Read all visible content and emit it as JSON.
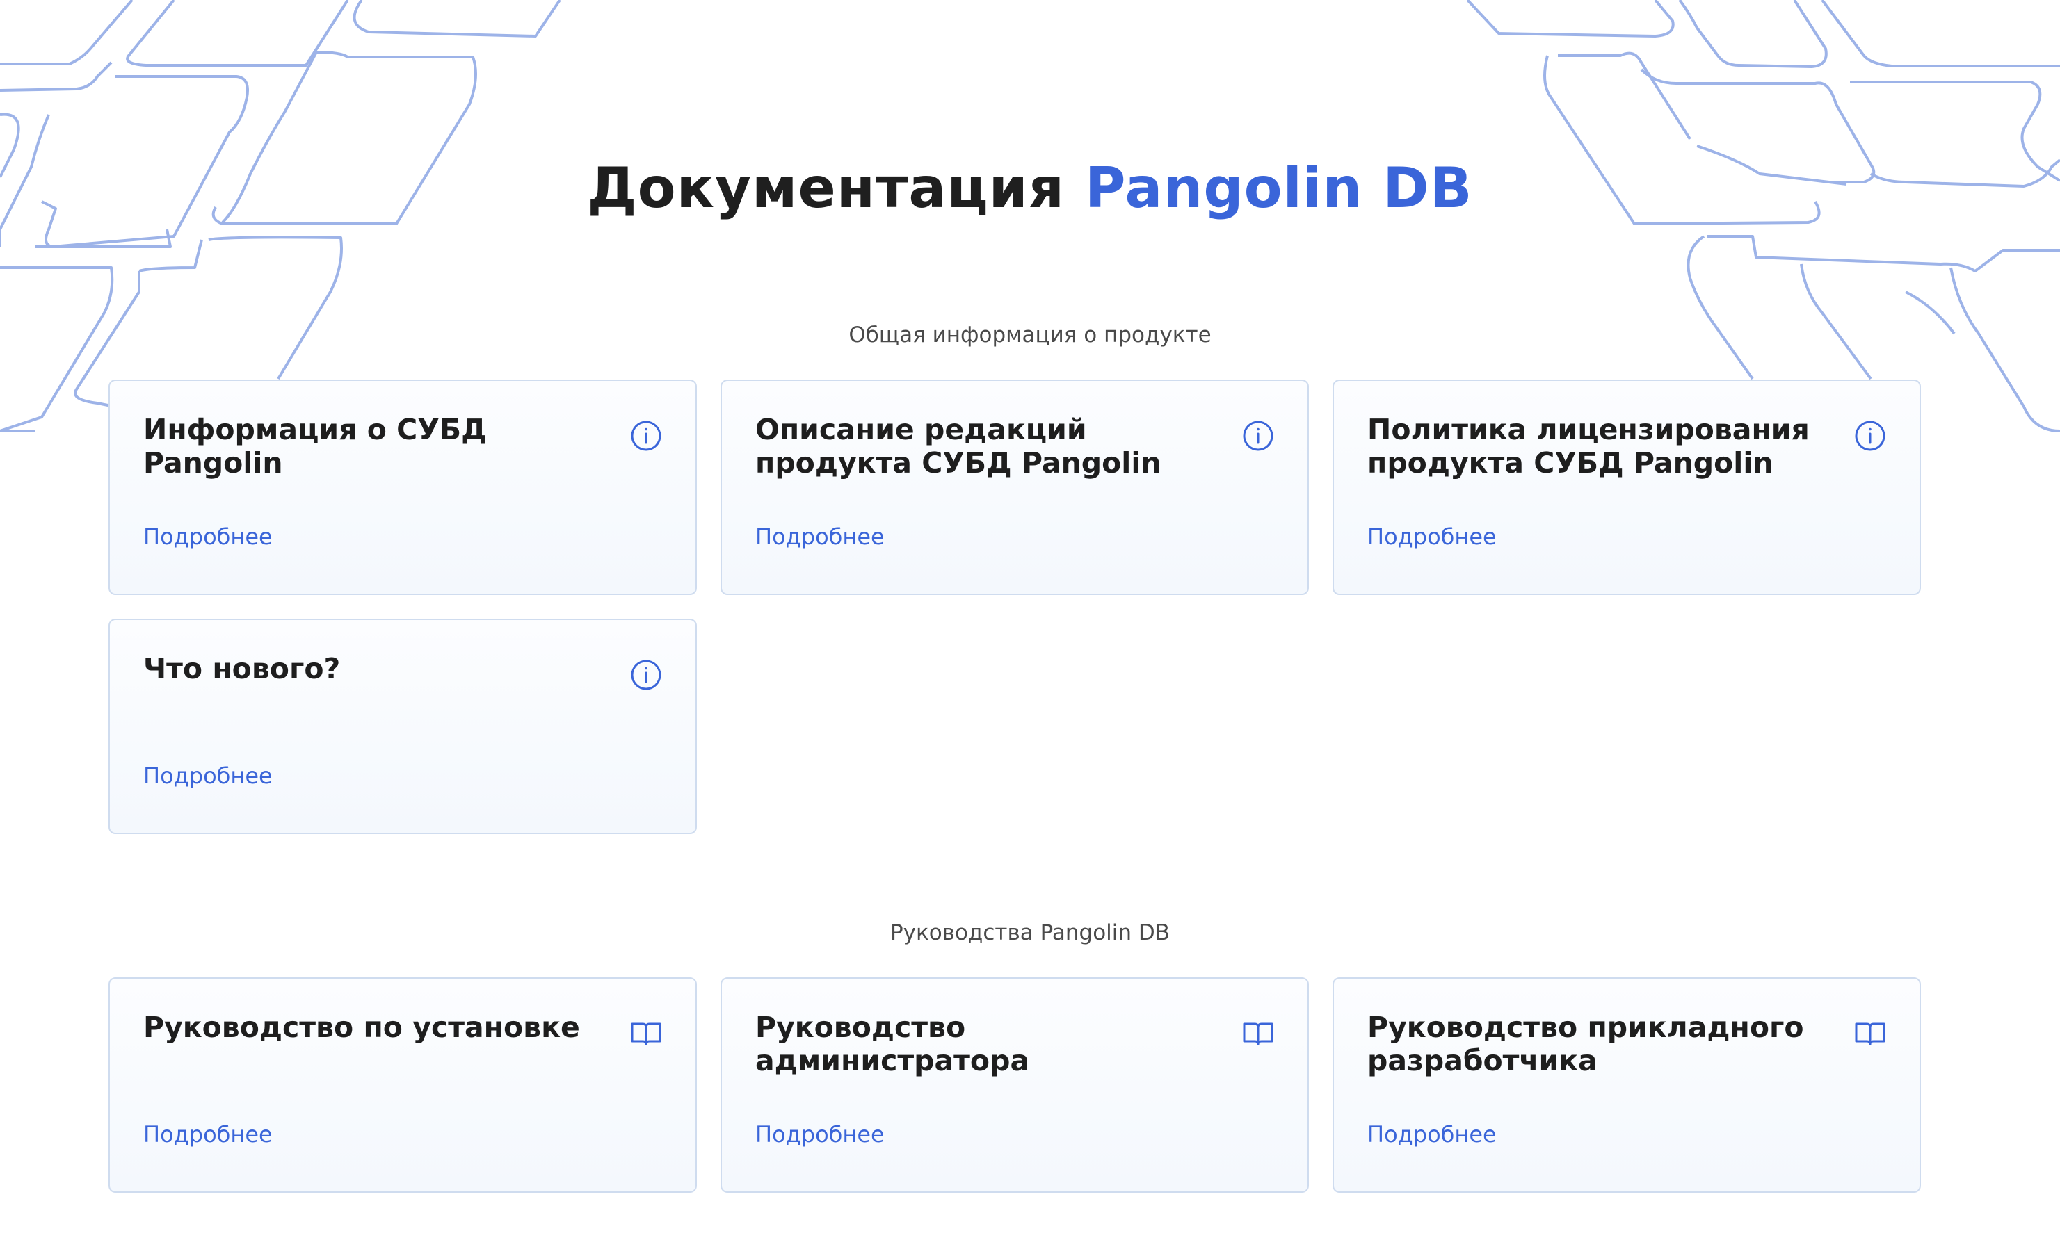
{
  "header": {
    "title_main": "Документация",
    "title_accent": "Pangolin DB"
  },
  "colors": {
    "accent": "#3a65d9",
    "text": "#1e1e1e",
    "card_border": "#cfdcef",
    "decoration_stroke": "#9db3e8"
  },
  "sections": [
    {
      "label": "Общая информация о продукте",
      "icon": "info-icon",
      "cards": [
        {
          "title": "Информация о СУБД Pangolin",
          "link": "Подробнее"
        },
        {
          "title": "Описание редакций продукта СУБД Pangolin",
          "link": "Подробнее"
        },
        {
          "title": "Политика лицензирования продукта СУБД Pangolin",
          "link": "Подробнее"
        },
        {
          "title": "Что нового?",
          "link": "Подробнее"
        }
      ]
    },
    {
      "label": "Руководства Pangolin DB",
      "icon": "book-icon",
      "cards": [
        {
          "title": "Руководство по установке",
          "link": "Подробнее"
        },
        {
          "title": "Руководство администратора",
          "link": "Подробнее"
        },
        {
          "title": "Руководство прикладного разработчика",
          "link": "Подробнее"
        }
      ]
    }
  ]
}
